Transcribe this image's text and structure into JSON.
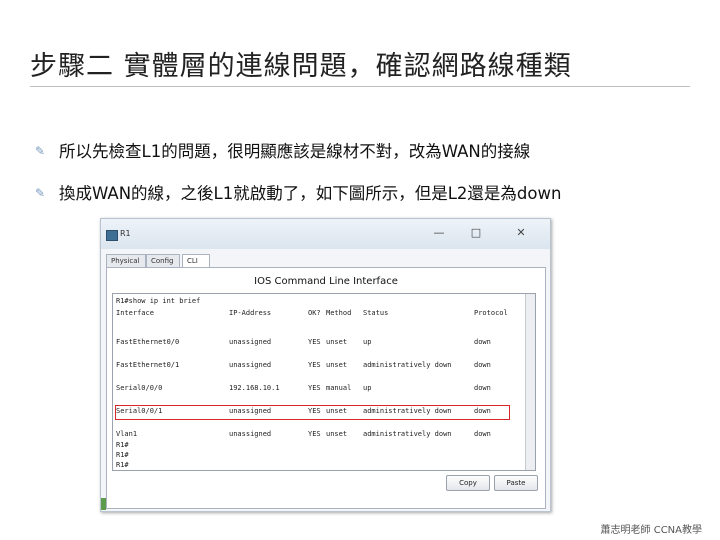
{
  "slide": {
    "title": "步驟二 實體層的連線問題，確認網路線種類",
    "bullets": [
      "所以先檢查L1的問題，很明顯應該是線材不對，改為WAN的接線",
      "換成WAN的線，之後L1就啟動了，如下圖所示，但是L2還是為down"
    ],
    "footer": "蕭志明老師 CCNA教學"
  },
  "window": {
    "title": "R1",
    "minimize": "—",
    "maximize": "□",
    "close": "✕",
    "tabs": [
      "Physical",
      "Config",
      "CLI"
    ],
    "active_tab": "CLI",
    "heading": "IOS Command Line Interface",
    "copy_label": "Copy",
    "paste_label": "Paste"
  },
  "console": {
    "command": "R1#show ip int brief",
    "headers": [
      "Interface",
      "IP-Address",
      "OK?",
      "Method",
      "Status",
      "Protocol"
    ],
    "rows": [
      [
        "FastEthernet0/0",
        "unassigned",
        "YES",
        "unset",
        "up",
        "down"
      ],
      [
        "FastEthernet0/1",
        "unassigned",
        "YES",
        "unset",
        "administratively down",
        "down"
      ],
      [
        "Serial0/0/0",
        "192.168.10.1",
        "YES",
        "manual",
        "up",
        "down"
      ],
      [
        "Serial0/0/1",
        "unassigned",
        "YES",
        "unset",
        "administratively down",
        "down"
      ],
      [
        "Vlan1",
        "unassigned",
        "YES",
        "unset",
        "administratively down",
        "down"
      ]
    ],
    "highlighted_row": "Serial0/0/0",
    "prompts": [
      "R1#",
      "R1#",
      "R1#"
    ]
  }
}
